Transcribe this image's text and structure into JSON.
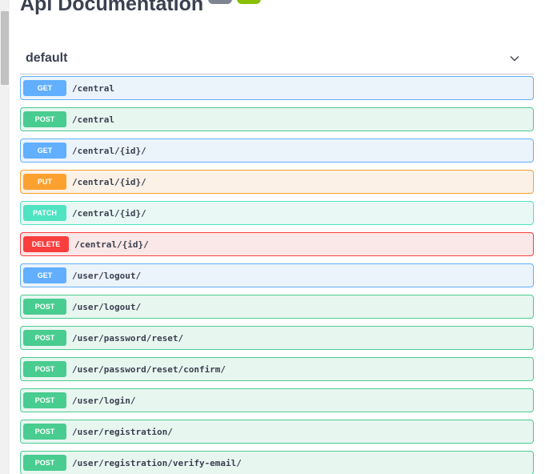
{
  "header": {
    "title": "Api Documentation"
  },
  "tag": {
    "name": "default",
    "expanded": true
  },
  "colors": {
    "get": "#61affe",
    "post": "#49cc90",
    "put": "#fca130",
    "patch": "#50e3c2",
    "delete": "#f93e3e"
  },
  "operations": [
    {
      "method": "GET",
      "path": "/central"
    },
    {
      "method": "POST",
      "path": "/central"
    },
    {
      "method": "GET",
      "path": "/central/{id}/"
    },
    {
      "method": "PUT",
      "path": "/central/{id}/"
    },
    {
      "method": "PATCH",
      "path": "/central/{id}/"
    },
    {
      "method": "DELETE",
      "path": "/central/{id}/"
    },
    {
      "method": "GET",
      "path": "/user/logout/"
    },
    {
      "method": "POST",
      "path": "/user/logout/"
    },
    {
      "method": "POST",
      "path": "/user/password/reset/"
    },
    {
      "method": "POST",
      "path": "/user/password/reset/confirm/"
    },
    {
      "method": "POST",
      "path": "/user/login/"
    },
    {
      "method": "POST",
      "path": "/user/registration/"
    },
    {
      "method": "POST",
      "path": "/user/registration/verify-email/"
    }
  ],
  "icons": {
    "collapse": "chevron-down-icon"
  }
}
